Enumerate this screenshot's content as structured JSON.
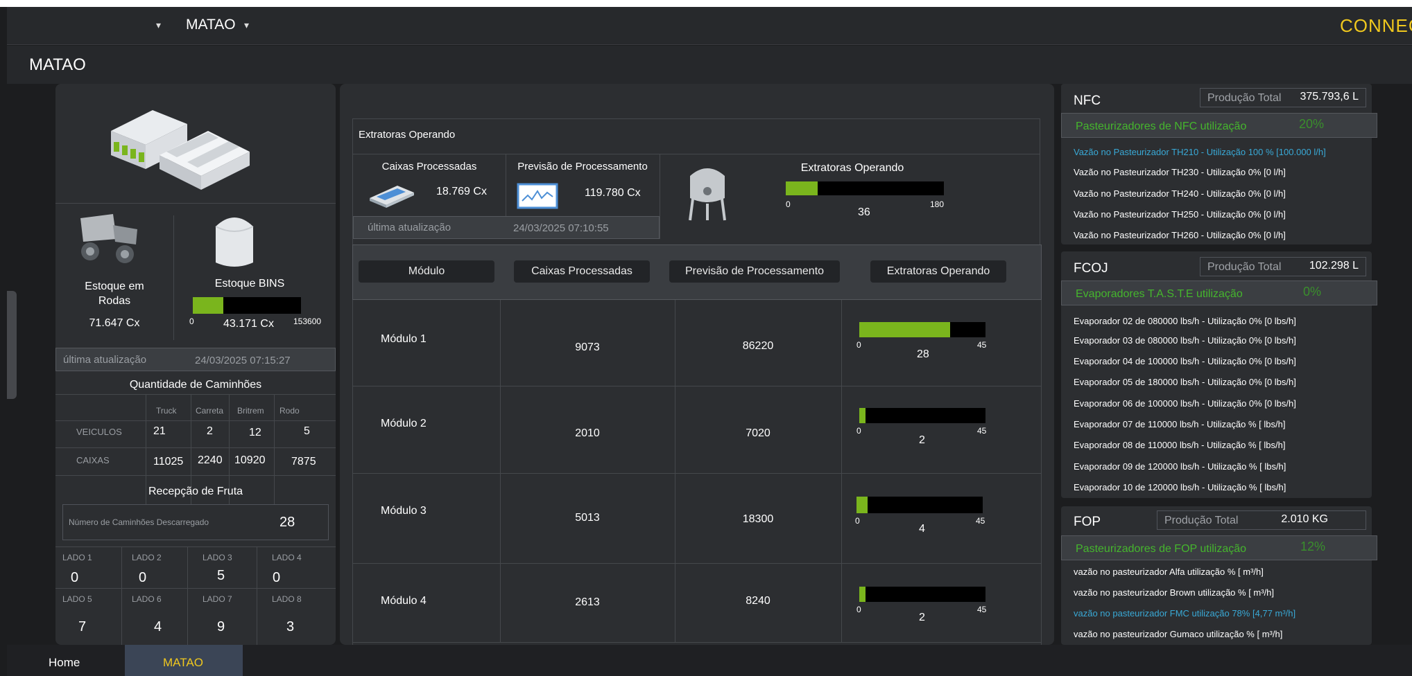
{
  "topbar": {
    "dropdown1_icon": "▾",
    "plant": "MATAO",
    "dropdown2_icon": "▾",
    "brand": "CONNECT"
  },
  "title": "MATAO",
  "left": {
    "estoque_rodas_label": "Estoque em\nRodas",
    "estoque_rodas_value": "71.647 Cx",
    "estoque_bins_label": "Estoque BINS",
    "bins_min": "0",
    "bins_value": "43.171 Cx",
    "bins_max": "153600",
    "bins_fraction": 0.281,
    "last_update_label": "última atualização",
    "last_update_value": "24/03/2025 07:15:27",
    "trucks_title": "Quantidade de Caminhões",
    "truck_headers": [
      "Truck",
      "Carreta",
      "Britrem",
      "Rodo"
    ],
    "veiculos_label": "VEICULOS",
    "veiculos": [
      "21",
      "2",
      "12",
      "5"
    ],
    "caixas_label": "CAIXAS",
    "caixas": [
      "11025",
      "2240",
      "10920",
      "7875"
    ],
    "recepcao_title": "Recepção de Fruta",
    "descarregado_label": "Número de Caminhões Descarregado",
    "descarregado_value": "28",
    "lados": [
      {
        "label": "LADO 1",
        "value": "0"
      },
      {
        "label": "LADO 2",
        "value": "0"
      },
      {
        "label": "LADO 3",
        "value": "5"
      },
      {
        "label": "LADO 4",
        "value": "0"
      },
      {
        "label": "LADO 5",
        "value": "7"
      },
      {
        "label": "LADO 6",
        "value": "4"
      },
      {
        "label": "LADO 7",
        "value": "9"
      },
      {
        "label": "LADO 8",
        "value": "3"
      }
    ]
  },
  "mid": {
    "section_title": "Extratoras Operando",
    "caixas_label": "Caixas Processadas",
    "caixas_value": "18.769 Cx",
    "previsao_label": "Previsão de Processamento",
    "previsao_value": "119.780 Cx",
    "last_update_label": "última atualização",
    "last_update_value": "24/03/2025 07:10:55",
    "extratoras_label": "Extratoras Operando",
    "extratoras_min": "0",
    "extratoras_max": "180",
    "extratoras_value": "36",
    "extratoras_fraction": 0.2,
    "headers": [
      "Módulo",
      "Caixas Processadas",
      "Previsão de Processamento",
      "Extratoras Operando"
    ],
    "modules": [
      {
        "name": "Módulo 1",
        "caixas": "9073",
        "previsao": "86220",
        "min": "0",
        "max": "45",
        "value": "28",
        "fraction": 0.72
      },
      {
        "name": "Módulo 2",
        "caixas": "2010",
        "previsao": "7020",
        "min": "0",
        "max": "45",
        "value": "2",
        "fraction": 0.05
      },
      {
        "name": "Módulo 3",
        "caixas": "5013",
        "previsao": "18300",
        "min": "0",
        "max": "45",
        "value": "4",
        "fraction": 0.09
      },
      {
        "name": "Módulo 4",
        "caixas": "2613",
        "previsao": "8240",
        "min": "0",
        "max": "45",
        "value": "2",
        "fraction": 0.05
      }
    ]
  },
  "nfc": {
    "title": "NFC",
    "prod_label": "Produção Total",
    "prod_value": "375.793,6 L",
    "util_label": "Pasteurizadores de NFC utilização",
    "util_pct": "20%",
    "lines": [
      {
        "text": "Vazão no Pasteurizador TH210 - Utilização 100 % [100.000 l/h]",
        "color": "#39a9d6"
      },
      {
        "text": "Vazão no Pasteurizador TH230 - Utilização 0% [0 l/h]",
        "color": "#ffffff"
      },
      {
        "text": "Vazão no Pasteurizador TH240 - Utilização 0% [0 l/h]",
        "color": "#ffffff"
      },
      {
        "text": "Vazão no Pasteurizador TH250 - Utilização 0% [0 l/h]",
        "color": "#ffffff"
      },
      {
        "text": "Vazão no Pasteurizador TH260 - Utilização 0% [0 l/h]",
        "color": "#ffffff"
      }
    ]
  },
  "fcoj": {
    "title": "FCOJ",
    "prod_label": "Produção Total",
    "prod_value": "102.298 L",
    "util_label": "Evaporadores T.A.S.T.E utilização",
    "util_pct": "0%",
    "lines": [
      "Evaporador 02 de 080000 lbs/h - Utilização 0% [0 lbs/h]",
      "Evaporador 03 de 080000 lbs/h - Utilização 0% [0 lbs/h]",
      "Evaporador 04 de 100000 lbs/h - Utilização 0% [0 lbs/h]",
      "Evaporador 05 de 180000 lbs/h - Utilização 0% [0 lbs/h]",
      "Evaporador 06 de 100000 lbs/h - Utilização 0% [0 lbs/h]",
      "Evaporador 07 de 110000 lbs/h - Utilização % [ lbs/h]",
      "Evaporador 08 de 110000 lbs/h - Utilização % [ lbs/h]",
      "Evaporador 09 de 120000 lbs/h - Utilização % [ lbs/h]",
      "Evaporador 10 de 120000 lbs/h - Utilização % [ lbs/h]"
    ]
  },
  "fop": {
    "title": "FOP",
    "prod_label": "Produção Total",
    "prod_value": "2.010 KG",
    "util_label": "Pasteurizadores de FOP utilização",
    "util_pct": "12%",
    "lines": [
      {
        "text": "vazão no pasteurizador Alfa utilização % [ m³/h]",
        "color": "#ffffff"
      },
      {
        "text": "vazão no pasteurizador Brown utilização % [ m³/h]",
        "color": "#ffffff"
      },
      {
        "text": "vazão no pasteurizador FMC utilização 78% [4,77 m³/h]",
        "color": "#39a9d6"
      },
      {
        "text": "vazão no pasteurizador Gumaco utilização % [ m³/h]",
        "color": "#ffffff"
      }
    ]
  },
  "bottom": {
    "home": "Home",
    "matao": "MATAO"
  },
  "colors": {
    "accent_green": "#7ab51d",
    "brand_yellow": "#f0c81e",
    "util_green": "#45b62d",
    "highlight_blue": "#39a9d6"
  }
}
